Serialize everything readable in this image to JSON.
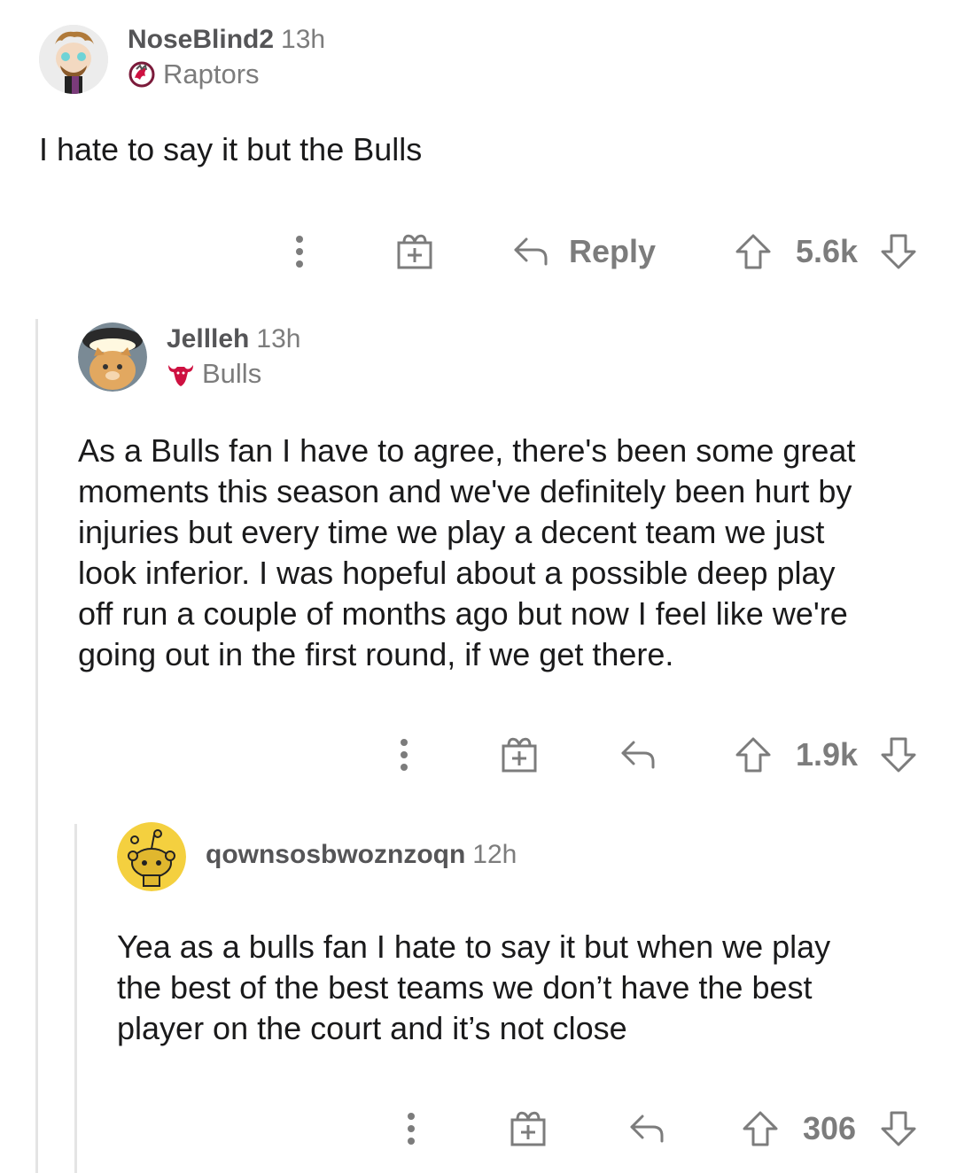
{
  "comments": [
    {
      "username": "NoseBlind2",
      "time": "13h",
      "flair": "Raptors",
      "flair_icon": "raptors-logo-icon",
      "body": "I hate to say it but the Bulls",
      "reply_label": "Reply",
      "score": "5.6k"
    },
    {
      "username": "Jellleh",
      "time": "13h",
      "flair": "Bulls",
      "flair_icon": "bulls-logo-icon",
      "body_lines": [
        "As a Bulls fan I have to agree, there's been some great",
        "moments this season and we've definitely been hurt by",
        "injuries but every time we play a decent team we just",
        "look inferior. I was hopeful about a possible deep play",
        "off run a couple of months ago but now I feel like we're",
        "going out in the first round, if we get there."
      ],
      "score": "1.9k"
    },
    {
      "username": "qownsosbwoznzoqn",
      "time": "12h",
      "body_lines": [
        "Yea as a bulls fan I hate to say it but when we play",
        "the best of the best teams we don’t have the best",
        "player on the court and it’s not close"
      ],
      "score": "306"
    }
  ],
  "colors": {
    "text": "#1a1a1b",
    "meta": "#7c7c7c",
    "thread_line": "#e4e4e4",
    "snoo_bg": "#f4d03f"
  }
}
